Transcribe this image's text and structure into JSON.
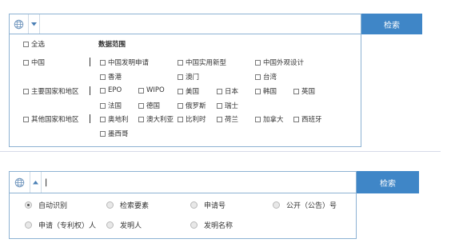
{
  "panel_a": {
    "search_button_label": "检索",
    "dropdown_state": "collapsed",
    "select_all_label": "全选",
    "data_range_heading": "数据范围",
    "group_china": "中国",
    "group_major": "主要国家和地区",
    "group_other": "其他国家和地区",
    "china_options": [
      "中国发明申请",
      "中国实用新型",
      "中国外观设计",
      "香港",
      "澳门",
      "台湾"
    ],
    "major_options": [
      "EPO",
      "WIPO",
      "美国",
      "日本",
      "韩国",
      "英国",
      "法国",
      "德国",
      "俄罗斯",
      "瑞士"
    ],
    "other_options": [
      "奥地利",
      "澳大利亚",
      "比利时",
      "荷兰",
      "加拿大",
      "西班牙",
      "墨西哥"
    ]
  },
  "panel_b": {
    "search_button_label": "检索",
    "search_value": "|",
    "dropdown_state": "expanded",
    "search_types": [
      {
        "label": "自动识别",
        "checked": true
      },
      {
        "label": "检索要素",
        "checked": false
      },
      {
        "label": "申请号",
        "checked": false
      },
      {
        "label": "公开（公告）号",
        "checked": false
      },
      {
        "label": "申请（专利权）人",
        "checked": false
      },
      {
        "label": "发明人",
        "checked": false
      },
      {
        "label": "发明名称",
        "checked": false
      }
    ]
  },
  "colors": {
    "accent": "#3f86c7",
    "border": "#8db2d3",
    "text": "#333333"
  },
  "icons": {
    "globe": "globe-icon",
    "triangle_down": "triangle-down-icon",
    "triangle_up": "triangle-up-icon"
  }
}
